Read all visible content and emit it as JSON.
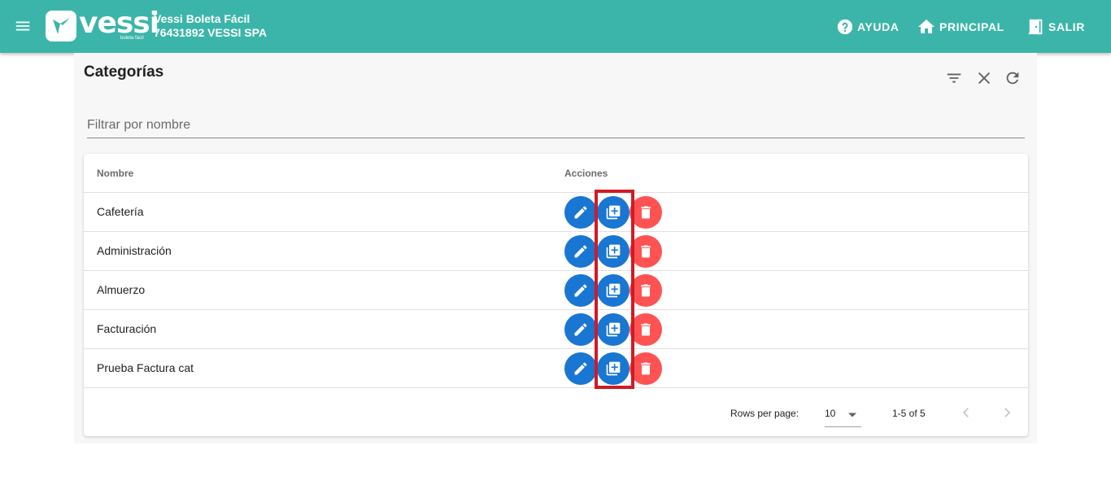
{
  "appbar": {
    "logo_text": "vessi",
    "logo_sub": "boleta fácil",
    "app_title": "Vessi Boleta Fácil",
    "company": "76431892 VESSI SPA",
    "nav": {
      "help": "AYUDA",
      "home": "PRINCIPAL",
      "logout": "SALIR"
    }
  },
  "page": {
    "title": "Categorías",
    "filter_placeholder": "Filtrar por nombre",
    "filter_value": ""
  },
  "table": {
    "headers": {
      "name": "Nombre",
      "actions": "Acciones"
    },
    "rows": [
      {
        "name": "Cafetería"
      },
      {
        "name": "Administración"
      },
      {
        "name": "Almuerzo"
      },
      {
        "name": "Facturación"
      },
      {
        "name": "Prueba Factura cat"
      }
    ],
    "footer": {
      "rows_per_page_label": "Rows per page:",
      "rows_per_page_value": "10",
      "page_info": "1-5 of 5"
    }
  },
  "colors": {
    "primary": "#3bb5a9",
    "action_blue": "#1976d2",
    "action_red": "#ff5252",
    "highlight": "#d21a24"
  }
}
